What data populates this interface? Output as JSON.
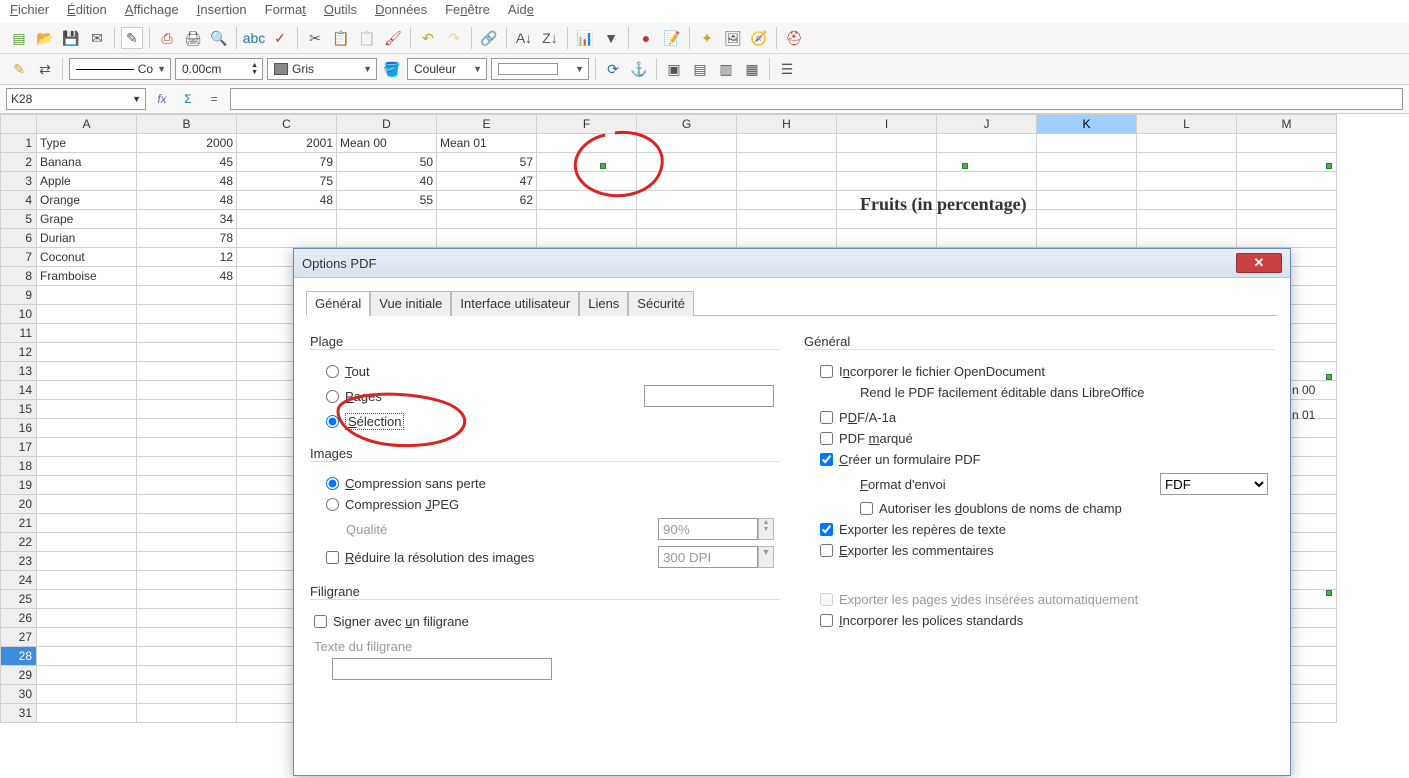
{
  "menu": {
    "items": [
      "Fichier",
      "Édition",
      "Affichage",
      "Insertion",
      "Format",
      "Outils",
      "Données",
      "Fenêtre",
      "Aide"
    ]
  },
  "toolbar2": {
    "lineStyle": "Co",
    "lineWidth": "0.00cm",
    "colorName": "Gris",
    "fillLabel": "Couleur"
  },
  "formula": {
    "cellRef": "K28"
  },
  "sheet": {
    "cols": [
      "A",
      "B",
      "C",
      "D",
      "E",
      "F",
      "G",
      "H",
      "I",
      "J",
      "K",
      "L",
      "M"
    ],
    "rows": [
      {
        "n": 1,
        "cells": [
          "Type",
          "2000",
          "2001",
          "Mean 00",
          "Mean 01"
        ]
      },
      {
        "n": 2,
        "cells": [
          "Banana",
          "45",
          "79",
          "50",
          "57"
        ]
      },
      {
        "n": 3,
        "cells": [
          "Apple",
          "48",
          "75",
          "40",
          "47"
        ]
      },
      {
        "n": 4,
        "cells": [
          "Orange",
          "48",
          "48",
          "55",
          "62"
        ]
      },
      {
        "n": 5,
        "cells": [
          "Grape",
          "34"
        ]
      },
      {
        "n": 6,
        "cells": [
          "Durian",
          "78"
        ]
      },
      {
        "n": 7,
        "cells": [
          "Coconut",
          "12"
        ]
      },
      {
        "n": 8,
        "cells": [
          "Framboise",
          "48"
        ]
      }
    ],
    "selectedRow": 28,
    "selectedCol": "K",
    "emptyRowsTo": 31
  },
  "chart": {
    "title": "Fruits (in percentage)",
    "legend": [
      "n 00",
      "n 01"
    ]
  },
  "dialog": {
    "title": "Options PDF",
    "tabs": [
      "Général",
      "Vue initiale",
      "Interface utilisateur",
      "Liens",
      "Sécurité"
    ],
    "activeTab": 0,
    "left": {
      "group_plage": "Plage",
      "opt_tout": "Tout",
      "opt_pages": "Pages",
      "opt_selection": "Sélection",
      "group_images": "Images",
      "opt_lossless": "Compression sans perte",
      "opt_jpeg": "Compression JPEG",
      "lbl_quality": "Qualité",
      "val_quality": "90%",
      "opt_reduce": "Réduire la résolution des images",
      "val_dpi": "300 DPI",
      "group_filigrane": "Filigrane",
      "opt_sign": "Signer avec un filigrane",
      "lbl_text": "Texte du filigrane"
    },
    "right": {
      "group_general": "Général",
      "opt_embed": "Incorporer le fichier OpenDocument",
      "hint_embed": "Rend le PDF facilement éditable dans LibreOffice",
      "opt_pdfa": "PDF/A-1a",
      "opt_marked": "PDF marqué",
      "opt_form": "Créer un formulaire PDF",
      "lbl_format": "Format d'envoi",
      "val_format": "FDF",
      "opt_dup": "Autoriser les doublons de noms de champ",
      "opt_bookmarks": "Exporter les repères de texte",
      "opt_comments": "Exporter les commentaires",
      "opt_blank": "Exporter les pages vides insérées automatiquement",
      "opt_fonts": "Incorporer les polices standards"
    }
  }
}
